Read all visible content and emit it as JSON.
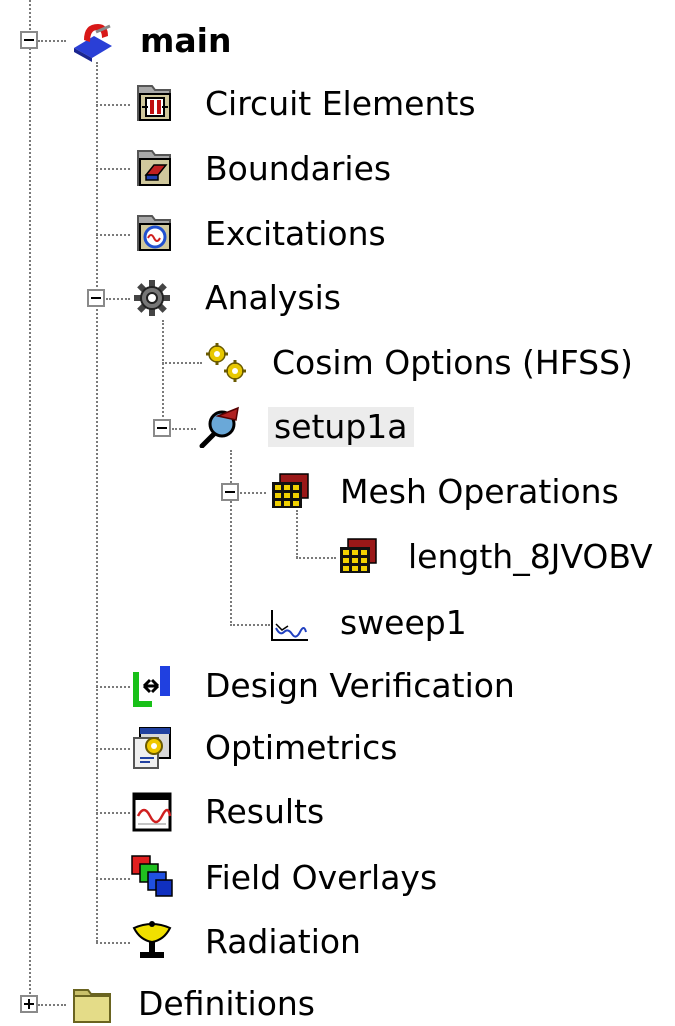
{
  "tree": {
    "main": {
      "label": "main",
      "icon": "hfss-design-icon",
      "expanded": true
    },
    "circuit_elements": {
      "label": "Circuit Elements",
      "icon": "circuit-elements-folder-icon"
    },
    "boundaries": {
      "label": "Boundaries",
      "icon": "boundaries-folder-icon"
    },
    "excitations": {
      "label": "Excitations",
      "icon": "excitations-folder-icon"
    },
    "analysis": {
      "label": "Analysis",
      "icon": "analysis-gear-icon",
      "expanded": true
    },
    "cosim_options": {
      "label": "Cosim Options (HFSS)",
      "icon": "cosim-gears-icon"
    },
    "setup1a": {
      "label": "setup1a",
      "icon": "setup-magnifier-icon",
      "expanded": true,
      "selected": true
    },
    "mesh_operations": {
      "label": "Mesh Operations",
      "icon": "mesh-operations-icon",
      "expanded": true
    },
    "length_op": {
      "label": "length_8JVOBV",
      "icon": "mesh-operation-icon"
    },
    "sweep1": {
      "label": "sweep1",
      "icon": "frequency-sweep-icon"
    },
    "design_verification": {
      "label": "Design Verification",
      "icon": "design-verification-icon"
    },
    "optimetrics": {
      "label": "Optimetrics",
      "icon": "optimetrics-icon"
    },
    "results": {
      "label": "Results",
      "icon": "results-icon"
    },
    "field_overlays": {
      "label": "Field Overlays",
      "icon": "field-overlays-icon"
    },
    "radiation": {
      "label": "Radiation",
      "icon": "radiation-icon"
    },
    "definitions": {
      "label": "Definitions",
      "icon": "definitions-folder-icon",
      "expanded": false
    }
  }
}
